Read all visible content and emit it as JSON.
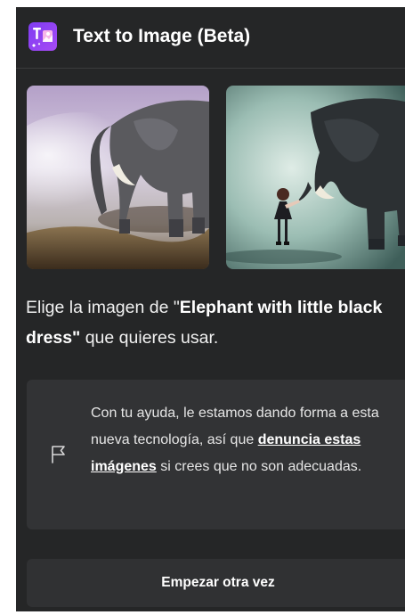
{
  "header": {
    "title": "Text to Image (Beta)",
    "icon": "text-to-image-app-icon",
    "icon_color": "#8b3ff4"
  },
  "results": {
    "images": [
      {
        "name": "elephant-result-1"
      },
      {
        "name": "elephant-result-2"
      }
    ]
  },
  "description": {
    "prefix": "Elige la imagen de \"",
    "prompt": "Elephant with little black dress",
    "suffix": "\" que quieres usar."
  },
  "feedback": {
    "icon": "flag-icon",
    "text_before": "Con tu ayuda, le estamos dando forma a esta nueva tecnología, así que ",
    "link_label": "denuncia estas imágenes",
    "text_after": " si crees que no son adecuadas."
  },
  "actions": {
    "restart_label": "Empezar otra vez"
  },
  "theme": {
    "panel_background": "#252627",
    "card_background": "#323335",
    "accent": "#8b3ff4"
  }
}
